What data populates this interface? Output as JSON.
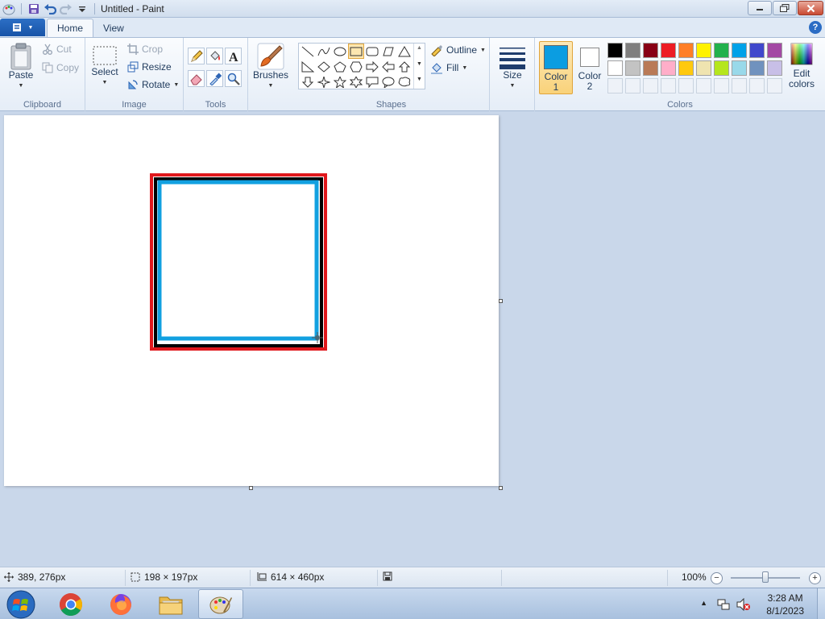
{
  "window": {
    "title": "Untitled - Paint"
  },
  "tabs": {
    "home": "Home",
    "view": "View"
  },
  "clipboard": {
    "paste": "Paste",
    "cut": "Cut",
    "copy": "Copy",
    "group": "Clipboard"
  },
  "image": {
    "select": "Select",
    "crop": "Crop",
    "resize": "Resize",
    "rotate": "Rotate",
    "group": "Image"
  },
  "tools": {
    "group": "Tools"
  },
  "brushes": {
    "label": "Brushes"
  },
  "shapes": {
    "outline": "Outline",
    "fill": "Fill",
    "group": "Shapes"
  },
  "size": {
    "label": "Size"
  },
  "colors": {
    "color1_line1": "Color",
    "color1_line2": "1",
    "color2_line1": "Color",
    "color2_line2": "2",
    "edit_line1": "Edit",
    "edit_line2": "colors",
    "group": "Colors",
    "color1_value": "#0b9de1",
    "color2_value": "#ffffff",
    "palette_row1": [
      "#000000",
      "#7f7f7f",
      "#880015",
      "#ed1c24",
      "#ff7f27",
      "#fff200",
      "#22b14c",
      "#00a2e8",
      "#3f48cc",
      "#a349a4"
    ],
    "palette_row2": [
      "#ffffff",
      "#c3c3c3",
      "#b97a57",
      "#ffaec9",
      "#ffc90e",
      "#efe4b0",
      "#b5e61d",
      "#99d9ea",
      "#7092be",
      "#c8bfe7"
    ]
  },
  "canvas": {
    "drawing_colors": {
      "red": "#e0181c",
      "black": "#000000",
      "blue": "#12a0e0"
    }
  },
  "status": {
    "cursor_pos": "389, 276px",
    "selection_size": "198 × 197px",
    "image_size": "614 × 460px",
    "zoom": "100%"
  },
  "taskbar": {
    "apps": [
      "Chrome",
      "Firefox",
      "File Explorer",
      "Paint"
    ],
    "time": "3:28 AM",
    "date": "8/1/2023"
  }
}
